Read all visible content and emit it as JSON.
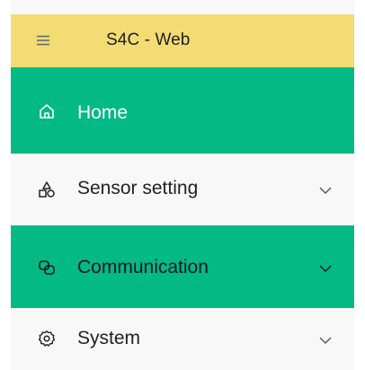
{
  "header": {
    "title": "S4C - Web",
    "menu_icon": "hamburger-icon",
    "background_color": "#f2dc73"
  },
  "nav": {
    "active_color": "#03b984",
    "items": [
      {
        "label": "Home",
        "icon": "home-icon",
        "active": true,
        "expandable": false
      },
      {
        "label": "Sensor setting",
        "icon": "sensor-icon",
        "active": false,
        "expandable": true
      },
      {
        "label": "Communication",
        "icon": "communication-icon",
        "active": true,
        "expandable": true
      },
      {
        "label": "System",
        "icon": "settings-icon",
        "active": false,
        "expandable": true
      }
    ]
  }
}
